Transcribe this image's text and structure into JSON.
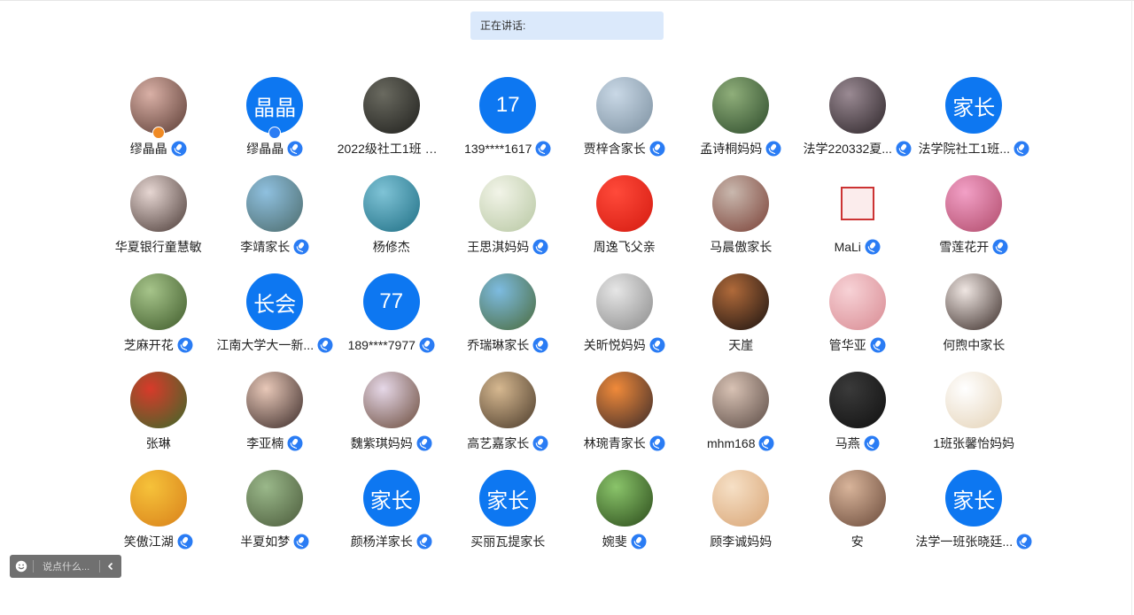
{
  "speaking_bar": {
    "label": "正在讲话:"
  },
  "participants": [
    {
      "name": "缪晶晶",
      "mic": true,
      "avatar": {
        "type": "photo",
        "colors": [
          "#d9b0a6",
          "#5a3b33"
        ]
      },
      "badge": "orange"
    },
    {
      "name": "缪晶晶",
      "mic": true,
      "avatar": {
        "type": "text",
        "text": "晶晶",
        "colors": [
          "#0d77f1",
          "#0d77f1"
        ]
      },
      "badge": "blue"
    },
    {
      "name": "2022级社工1班 林...",
      "mic": false,
      "avatar": {
        "type": "photo",
        "colors": [
          "#6a6a60",
          "#1f1f1c"
        ]
      }
    },
    {
      "name": "139****1617",
      "mic": true,
      "avatar": {
        "type": "text",
        "text": "17",
        "colors": [
          "#0d77f1",
          "#0d77f1"
        ]
      }
    },
    {
      "name": "贾梓含家长",
      "mic": true,
      "avatar": {
        "type": "photo",
        "colors": [
          "#c9d8e6",
          "#7b8f9f"
        ]
      }
    },
    {
      "name": "孟诗桐妈妈",
      "mic": true,
      "avatar": {
        "type": "photo",
        "colors": [
          "#8fae7a",
          "#2c4a2a"
        ]
      }
    },
    {
      "name": "法学220332夏...",
      "mic": true,
      "avatar": {
        "type": "photo",
        "colors": [
          "#9a8a93",
          "#2c2428"
        ]
      }
    },
    {
      "name": "法学院社工1班...",
      "mic": true,
      "avatar": {
        "type": "text",
        "text": "家长",
        "colors": [
          "#0d77f1",
          "#0d77f1"
        ]
      }
    },
    {
      "name": "华夏银行童慧敏",
      "mic": false,
      "avatar": {
        "type": "photo",
        "colors": [
          "#e6d6d2",
          "#4a3a36"
        ]
      }
    },
    {
      "name": "李靖家长",
      "mic": true,
      "avatar": {
        "type": "photo",
        "colors": [
          "#8fc0df",
          "#4b6a6a"
        ]
      }
    },
    {
      "name": "杨修杰",
      "mic": false,
      "avatar": {
        "type": "photo",
        "colors": [
          "#7fc3d6",
          "#1e6e84"
        ]
      }
    },
    {
      "name": "王思淇妈妈",
      "mic": true,
      "avatar": {
        "type": "photo",
        "colors": [
          "#f2f4e8",
          "#b7c7a2"
        ]
      }
    },
    {
      "name": "周逸飞父亲",
      "mic": false,
      "avatar": {
        "type": "photo",
        "colors": [
          "#ff4a3a",
          "#d41a10"
        ]
      }
    },
    {
      "name": "马晨傲家长",
      "mic": false,
      "avatar": {
        "type": "photo",
        "colors": [
          "#c9b8ae",
          "#7a4036"
        ]
      }
    },
    {
      "name": "MaLi",
      "mic": true,
      "avatar": {
        "type": "stamp",
        "colors": [
          "#ffffff",
          "#ffffff"
        ]
      }
    },
    {
      "name": "雪莲花开",
      "mic": true,
      "avatar": {
        "type": "photo",
        "colors": [
          "#f2a0c6",
          "#b04a6a"
        ]
      }
    },
    {
      "name": "芝麻开花",
      "mic": true,
      "avatar": {
        "type": "photo",
        "colors": [
          "#a6c48a",
          "#3e5a2a"
        ]
      }
    },
    {
      "name": "江南大学大一新...",
      "mic": true,
      "avatar": {
        "type": "text",
        "text": "长会",
        "colors": [
          "#0d77f1",
          "#0d77f1"
        ]
      }
    },
    {
      "name": "189****7977",
      "mic": true,
      "avatar": {
        "type": "text",
        "text": "77",
        "colors": [
          "#0d77f1",
          "#0d77f1"
        ]
      }
    },
    {
      "name": "乔瑞琳家长",
      "mic": true,
      "avatar": {
        "type": "photo",
        "colors": [
          "#7dbbe0",
          "#4a6a3a"
        ]
      }
    },
    {
      "name": "关昕悦妈妈",
      "mic": true,
      "avatar": {
        "type": "photo",
        "colors": [
          "#e6e6e6",
          "#8a8a8a"
        ]
      }
    },
    {
      "name": "天崖",
      "mic": false,
      "avatar": {
        "type": "photo",
        "colors": [
          "#b06a3a",
          "#1a1210"
        ]
      }
    },
    {
      "name": "管华亚",
      "mic": true,
      "avatar": {
        "type": "photo",
        "colors": [
          "#f7d2d6",
          "#d88a92"
        ]
      }
    },
    {
      "name": "何煦中家长",
      "mic": false,
      "avatar": {
        "type": "photo",
        "colors": [
          "#efe6e2",
          "#3a2c28"
        ]
      }
    },
    {
      "name": "张琳",
      "mic": false,
      "avatar": {
        "type": "photo",
        "colors": [
          "#d83a2a",
          "#3a6a2a"
        ]
      }
    },
    {
      "name": "李亚楠",
      "mic": true,
      "avatar": {
        "type": "photo",
        "colors": [
          "#e8c8b8",
          "#3a2a28"
        ]
      }
    },
    {
      "name": "魏紫琪妈妈",
      "mic": true,
      "avatar": {
        "type": "photo",
        "colors": [
          "#e6d8e8",
          "#6a4a3a"
        ]
      }
    },
    {
      "name": "高艺嘉家长",
      "mic": true,
      "avatar": {
        "type": "photo",
        "colors": [
          "#d6b890",
          "#4a3a2a"
        ]
      }
    },
    {
      "name": "林琬青家长",
      "mic": true,
      "avatar": {
        "type": "photo",
        "colors": [
          "#f08a3a",
          "#3a2a2a"
        ]
      }
    },
    {
      "name": "mhm168",
      "mic": true,
      "avatar": {
        "type": "photo",
        "colors": [
          "#d8c2b4",
          "#5a4a44"
        ]
      }
    },
    {
      "name": "马燕",
      "mic": true,
      "avatar": {
        "type": "photo",
        "colors": [
          "#3a3a3a",
          "#101010"
        ]
      }
    },
    {
      "name": "1班张馨怡妈妈",
      "mic": false,
      "avatar": {
        "type": "photo",
        "colors": [
          "#ffffff",
          "#e4d2b6"
        ]
      }
    },
    {
      "name": "笑傲江湖",
      "mic": true,
      "avatar": {
        "type": "photo",
        "colors": [
          "#f6c23a",
          "#d8801a"
        ]
      }
    },
    {
      "name": "半夏如梦",
      "mic": true,
      "avatar": {
        "type": "photo",
        "colors": [
          "#9ab88a",
          "#4a5a3a"
        ]
      }
    },
    {
      "name": "颜杨洋家长",
      "mic": true,
      "avatar": {
        "type": "text",
        "text": "家长",
        "colors": [
          "#0d77f1",
          "#0d77f1"
        ]
      }
    },
    {
      "name": "买丽瓦提家长",
      "mic": false,
      "avatar": {
        "type": "text",
        "text": "家长",
        "colors": [
          "#0d77f1",
          "#0d77f1"
        ]
      }
    },
    {
      "name": "婉斐",
      "mic": true,
      "avatar": {
        "type": "photo",
        "colors": [
          "#8ac46a",
          "#2a4a1a"
        ]
      }
    },
    {
      "name": "顾李诚妈妈",
      "mic": false,
      "avatar": {
        "type": "photo",
        "colors": [
          "#f6e0c6",
          "#d8a474"
        ]
      }
    },
    {
      "name": "安",
      "mic": false,
      "avatar": {
        "type": "photo",
        "colors": [
          "#d8b49a",
          "#6a4a3a"
        ]
      }
    },
    {
      "name": "法学一班张晓廷...",
      "mic": true,
      "avatar": {
        "type": "text",
        "text": "家长",
        "colors": [
          "#0d77f1",
          "#0d77f1"
        ]
      }
    }
  ],
  "chat_input": {
    "placeholder": "说点什么..."
  },
  "icons": {
    "emoji": "emoji-icon",
    "mic": "mic-icon",
    "collapse": "chevron-left-icon"
  },
  "colors": {
    "accent": "#0d77f1",
    "speaking_bg": "#dbe9fb",
    "chat_bg": "#707070"
  }
}
